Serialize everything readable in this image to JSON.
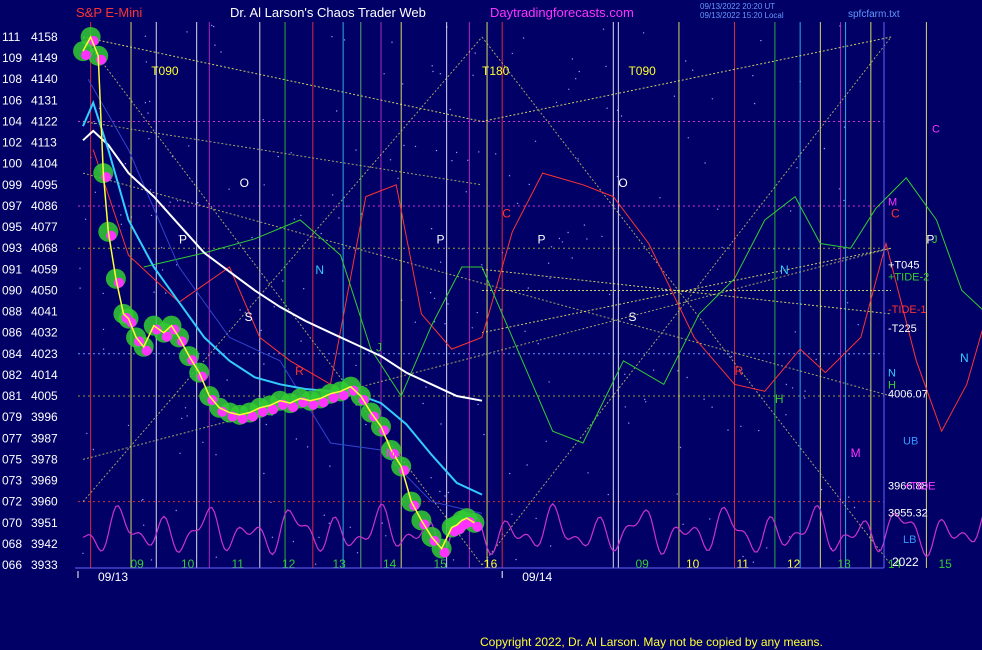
{
  "header": {
    "symbol": "S&P E-Mini",
    "title": "Dr. Al Larson's Chaos Trader Web",
    "site": "Daytradingforecasts.com",
    "stamp1": "09/13/2022 20:20 UT",
    "stamp2": "09/13/2022 15:20 Local",
    "file": "spfcfarm.txt"
  },
  "copyright": "Copyright 2022, Dr. Al Larson. May not be copied by any means.",
  "colors": {
    "background": "#000066",
    "price_dots": "#ff33ff",
    "price_glow": "#33cc33",
    "price_line": "#ffff33",
    "ma_fast": "#33ccff",
    "ma_slow": "#ffffff",
    "osc": "#cc33cc",
    "red_curve": "#ff3333",
    "green_curve": "#33cc33"
  },
  "chart_data": {
    "type": "line",
    "title": "S&P E-Mini",
    "ylim": [
      3933,
      4158
    ],
    "y_ticks": [
      {
        "code": "111",
        "price": 4158
      },
      {
        "code": "109",
        "price": 4149
      },
      {
        "code": "108",
        "price": 4140
      },
      {
        "code": "106",
        "price": 4131
      },
      {
        "code": "104",
        "price": 4122
      },
      {
        "code": "102",
        "price": 4113
      },
      {
        "code": "100",
        "price": 4104
      },
      {
        "code": "099",
        "price": 4095
      },
      {
        "code": "097",
        "price": 4086
      },
      {
        "code": "095",
        "price": 4077
      },
      {
        "code": "093",
        "price": 4068
      },
      {
        "code": "091",
        "price": 4059
      },
      {
        "code": "090",
        "price": 4050
      },
      {
        "code": "088",
        "price": 4041
      },
      {
        "code": "086",
        "price": 4032
      },
      {
        "code": "084",
        "price": 4023
      },
      {
        "code": "082",
        "price": 4014
      },
      {
        "code": "081",
        "price": 4005
      },
      {
        "code": "079",
        "price": 3996
      },
      {
        "code": "077",
        "price": 3987
      },
      {
        "code": "075",
        "price": 3978
      },
      {
        "code": "073",
        "price": 3969
      },
      {
        "code": "072",
        "price": 3960
      },
      {
        "code": "070",
        "price": 3951
      },
      {
        "code": "068",
        "price": 3942
      },
      {
        "code": "066",
        "price": 3933
      }
    ],
    "x_hour_ticks": [
      {
        "h": 9,
        "label": "09",
        "color": "green"
      },
      {
        "h": 10,
        "label": "10",
        "color": "green"
      },
      {
        "h": 11,
        "label": "11",
        "color": "green"
      },
      {
        "h": 12,
        "label": "12",
        "color": "green"
      },
      {
        "h": 13,
        "label": "13",
        "color": "green"
      },
      {
        "h": 14,
        "label": "14",
        "color": "green"
      },
      {
        "h": 15,
        "label": "15",
        "color": "green"
      },
      {
        "h": 16,
        "label": "16",
        "color": "yellow"
      },
      {
        "h": 19,
        "label": "09",
        "color": "green"
      },
      {
        "h": 20,
        "label": "10",
        "color": "yellow"
      },
      {
        "h": 21,
        "label": "11",
        "color": "yellow"
      },
      {
        "h": 22,
        "label": "12",
        "color": "yellow"
      },
      {
        "h": 23,
        "label": "13",
        "color": "green"
      },
      {
        "h": 24,
        "label": "14",
        "color": "green"
      },
      {
        "h": 25,
        "label": "15",
        "color": "green"
      },
      {
        "h": 26,
        "label": "13",
        "color": "green"
      }
    ],
    "dates": [
      {
        "h": 8.0,
        "label": "09/13"
      },
      {
        "h": 16.4,
        "label": "09/14"
      }
    ],
    "bottom_right_label": "2022",
    "price_series": {
      "name": "S&P E-Mini",
      "x_hours": [
        8.1,
        8.25,
        8.4,
        8.5,
        8.6,
        8.75,
        8.9,
        9.0,
        9.15,
        9.3,
        9.5,
        9.7,
        9.85,
        10.0,
        10.2,
        10.4,
        10.6,
        10.8,
        11.0,
        11.2,
        11.4,
        11.6,
        11.8,
        12.0,
        12.2,
        12.4,
        12.6,
        12.8,
        13.0,
        13.2,
        13.4,
        13.6,
        13.8,
        14.0,
        14.2,
        14.4,
        14.6,
        14.8,
        15.0,
        15.2,
        15.4,
        15.5,
        15.6,
        15.7,
        15.85
      ],
      "prices": [
        4152,
        4158,
        4150,
        4100,
        4075,
        4055,
        4040,
        4038,
        4030,
        4026,
        4035,
        4032,
        4035,
        4030,
        4022,
        4015,
        4005,
        4000,
        3998,
        3997,
        3998,
        4000,
        4001,
        4003,
        4002,
        4004,
        4003,
        4004,
        4006,
        4007,
        4009,
        4005,
        3998,
        3992,
        3982,
        3975,
        3960,
        3952,
        3945,
        3940,
        3949,
        3950,
        3952,
        3953,
        3951
      ]
    },
    "ma_fast": {
      "x_hours": [
        8.1,
        8.3,
        8.6,
        9.0,
        9.5,
        10.0,
        10.5,
        11.0,
        11.5,
        12.0,
        12.5,
        13.0,
        13.5,
        14.0,
        14.5,
        15.0,
        15.5,
        16.0
      ],
      "prices": [
        4120,
        4130,
        4110,
        4080,
        4060,
        4045,
        4030,
        4020,
        4013,
        4010,
        4008,
        4007,
        4006,
        4002,
        3993,
        3980,
        3968,
        3963
      ]
    },
    "ma_slow": {
      "x_hours": [
        8.1,
        8.3,
        8.6,
        9.0,
        9.5,
        10.0,
        10.5,
        11.0,
        11.5,
        12.0,
        12.5,
        13.0,
        13.5,
        14.0,
        14.5,
        15.0,
        15.5,
        16.0
      ],
      "prices": [
        4114,
        4118,
        4112,
        4100,
        4090,
        4078,
        4066,
        4058,
        4050,
        4043,
        4037,
        4032,
        4027,
        4022,
        4015,
        4010,
        4005,
        4003
      ]
    },
    "annotations": {
      "t_labels": [
        {
          "h": 9.45,
          "text": "T090"
        },
        {
          "h": 16.0,
          "text": "T180"
        },
        {
          "h": 18.9,
          "text": "T090"
        }
      ],
      "right_labels": [
        {
          "price": 4119,
          "text": "C",
          "color": "#ff33ff"
        },
        {
          "price": 4088,
          "text": "M",
          "color": "#ff33ff"
        },
        {
          "price": 4072,
          "text": "J",
          "color": "#33cc33"
        },
        {
          "price": 4061,
          "text": "+T045",
          "color": "#ffffff"
        },
        {
          "price": 4056,
          "text": "+TIDE-2",
          "color": "#33cc33"
        },
        {
          "price": 4042,
          "text": "-TIDE-1",
          "color": "#ff3333"
        },
        {
          "price": 4034,
          "text": "-T225",
          "color": "#ffffff"
        },
        {
          "price": 4015,
          "text": "N",
          "color": "#33ccff"
        },
        {
          "price": 4010,
          "text": "H",
          "color": "#33cc33"
        },
        {
          "price": 4006.07,
          "text": "4006.07",
          "color": "#ffffff"
        },
        {
          "price": 3986,
          "text": "UB",
          "color": "#3399ff"
        },
        {
          "price": 3966.88,
          "text": "3966.88",
          "color": "#ffffff"
        },
        {
          "price": 3966.88,
          "text": "+TIDE",
          "color": "#ff33ff"
        },
        {
          "price": 3955.32,
          "text": "3955.32",
          "color": "#ffffff"
        },
        {
          "price": 3944,
          "text": "LB",
          "color": "#3399ff"
        }
      ],
      "in_chart": [
        {
          "h": 11.2,
          "price": 4094,
          "text": "O",
          "color": "#ffffff"
        },
        {
          "h": 18.7,
          "price": 4094,
          "text": "O",
          "color": "#ffffff"
        },
        {
          "h": 10.0,
          "price": 4070,
          "text": "P",
          "color": "#ffffff"
        },
        {
          "h": 15.1,
          "price": 4070,
          "text": "P",
          "color": "#ffffff"
        },
        {
          "h": 17.1,
          "price": 4070,
          "text": "P",
          "color": "#ffffff"
        },
        {
          "h": 24.8,
          "price": 4070,
          "text": "P",
          "color": "#ffffff"
        },
        {
          "h": 12.7,
          "price": 4057,
          "text": "N",
          "color": "#33ccff"
        },
        {
          "h": 21.9,
          "price": 4057,
          "text": "N",
          "color": "#33ccff"
        },
        {
          "h": 11.3,
          "price": 4037,
          "text": "S",
          "color": "#ffffff"
        },
        {
          "h": 18.9,
          "price": 4037,
          "text": "S",
          "color": "#ffffff"
        },
        {
          "h": 13.9,
          "price": 4024,
          "text": "J",
          "color": "#33cc33"
        },
        {
          "h": 16.4,
          "price": 4081,
          "text": "C",
          "color": "#ff3333"
        },
        {
          "h": 24.1,
          "price": 4081,
          "text": "C",
          "color": "#ff3333"
        },
        {
          "h": 12.3,
          "price": 4014,
          "text": "R",
          "color": "#ff3333"
        },
        {
          "h": 14.1,
          "price": 3979,
          "text": "M",
          "color": "#ff33ff"
        },
        {
          "h": 23.3,
          "price": 3979,
          "text": "M",
          "color": "#ff33ff"
        },
        {
          "h": 21.0,
          "price": 4014,
          "text": "R",
          "color": "#ff3333"
        },
        {
          "h": 21.8,
          "price": 4002,
          "text": "H",
          "color": "#33cc33"
        }
      ]
    }
  }
}
